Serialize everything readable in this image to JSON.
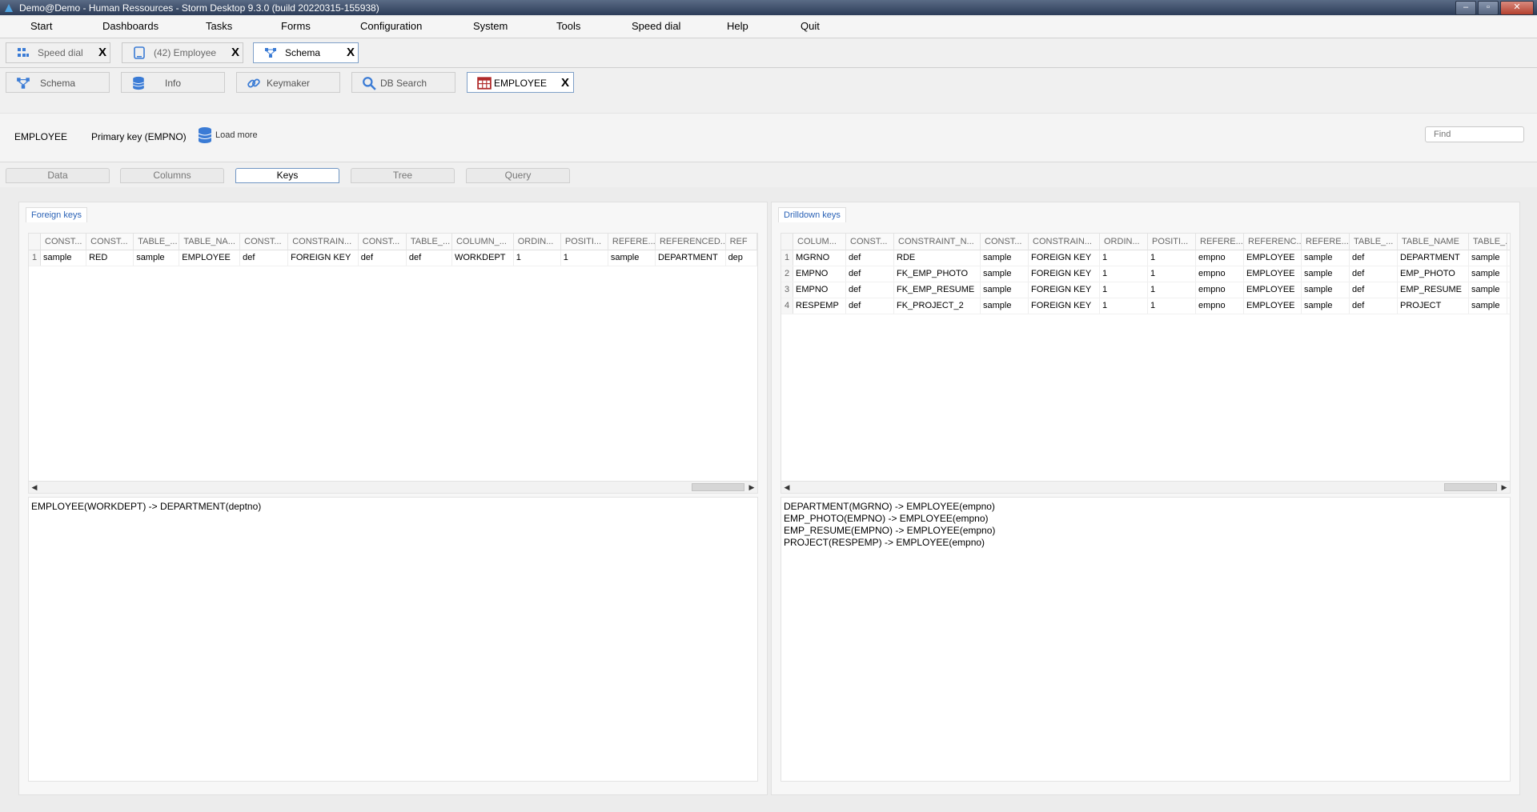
{
  "window": {
    "title": "Demo@Demo - Human Ressources -  Storm Desktop 9.3.0 (build 20220315-155938)",
    "controls": [
      "–",
      "▫",
      "✕"
    ]
  },
  "menu": [
    "Start",
    "Dashboards",
    "Tasks",
    "Forms",
    "Configuration",
    "System",
    "Tools",
    "Speed dial",
    "Help",
    "Quit"
  ],
  "app_tabs": [
    {
      "label": "Speed dial",
      "icon": "speed-dial-icon",
      "close": "X"
    },
    {
      "label": "(42) Employee",
      "icon": "tablet-icon",
      "close": "X"
    },
    {
      "label": "Schema",
      "icon": "schema-icon",
      "close": "X"
    }
  ],
  "schema_tabs": [
    {
      "label": "Schema",
      "icon": "schema-icon"
    },
    {
      "label": "Info",
      "icon": "database-icon"
    },
    {
      "label": "Keymaker",
      "icon": "link-icon"
    },
    {
      "label": "DB Search",
      "icon": "search-icon"
    },
    {
      "label": "EMPLOYEE",
      "icon": "table-icon",
      "close": "X"
    }
  ],
  "infobar": {
    "table": "EMPLOYEE",
    "primary_key": "Primary key (EMPNO)",
    "load_more": "Load more",
    "find_placeholder": "Find"
  },
  "sub_tabs": [
    "Data",
    "Columns",
    "Keys",
    "Tree",
    "Query"
  ],
  "active_sub_tab": "Keys",
  "foreign_keys": {
    "title": "Foreign keys",
    "columns": [
      "CONST...",
      "CONST...",
      "TABLE_...",
      "TABLE_NA...",
      "CONST...",
      "CONSTRAIN...",
      "CONST...",
      "TABLE_...",
      "COLUMN_...",
      "ORDIN...",
      "POSITI...",
      "REFERE...",
      "REFERENCED...",
      "REF"
    ],
    "rows": [
      [
        "1",
        "sample",
        "RED",
        "sample",
        "EMPLOYEE",
        "def",
        "FOREIGN KEY",
        "def",
        "def",
        "WORKDEPT",
        "1",
        "1",
        "sample",
        "DEPARTMENT",
        "dep"
      ]
    ],
    "text": [
      "EMPLOYEE(WORKDEPT) -> DEPARTMENT(deptno)"
    ]
  },
  "drilldown_keys": {
    "title": "Drilldown keys",
    "columns": [
      "COLUM...",
      "CONST...",
      "CONSTRAINT_N...",
      "CONST...",
      "CONSTRAIN...",
      "ORDIN...",
      "POSITI...",
      "REFERE...",
      "REFERENC...",
      "REFERE...",
      "TABLE_...",
      "TABLE_NAME",
      "TABLE_."
    ],
    "rows": [
      [
        "1",
        "MGRNO",
        "def",
        "RDE",
        "sample",
        "FOREIGN KEY",
        "1",
        "1",
        "empno",
        "EMPLOYEE",
        "sample",
        "def",
        "DEPARTMENT",
        "sample"
      ],
      [
        "2",
        "EMPNO",
        "def",
        "FK_EMP_PHOTO",
        "sample",
        "FOREIGN KEY",
        "1",
        "1",
        "empno",
        "EMPLOYEE",
        "sample",
        "def",
        "EMP_PHOTO",
        "sample"
      ],
      [
        "3",
        "EMPNO",
        "def",
        "FK_EMP_RESUME",
        "sample",
        "FOREIGN KEY",
        "1",
        "1",
        "empno",
        "EMPLOYEE",
        "sample",
        "def",
        "EMP_RESUME",
        "sample"
      ],
      [
        "4",
        "RESPEMP",
        "def",
        "FK_PROJECT_2",
        "sample",
        "FOREIGN KEY",
        "1",
        "1",
        "empno",
        "EMPLOYEE",
        "sample",
        "def",
        "PROJECT",
        "sample"
      ]
    ],
    "text": [
      "DEPARTMENT(MGRNO) -> EMPLOYEE(empno)",
      "EMP_PHOTO(EMPNO) -> EMPLOYEE(empno)",
      "EMP_RESUME(EMPNO) -> EMPLOYEE(empno)",
      "PROJECT(RESPEMP) -> EMPLOYEE(empno)"
    ]
  },
  "scroll_arrows": {
    "left": "◀",
    "right": "▶"
  }
}
